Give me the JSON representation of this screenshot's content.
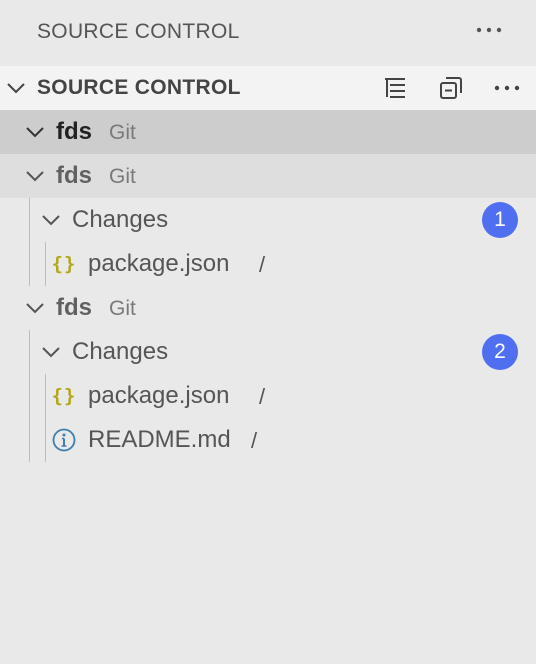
{
  "view": {
    "title": "SOURCE CONTROL",
    "more_icon": "ellipsis-icon"
  },
  "section": {
    "title": "SOURCE CONTROL",
    "actions": [
      {
        "name": "view-as-tree",
        "icon": "list-tree-icon"
      },
      {
        "name": "collapse-all",
        "icon": "collapse-all-icon"
      },
      {
        "name": "more-actions",
        "icon": "ellipsis-icon"
      }
    ]
  },
  "repositories": [
    {
      "name": "fds",
      "kind": "Git",
      "state": "selected"
    },
    {
      "name": "fds",
      "kind": "Git",
      "state": "hover",
      "group": {
        "label": "Changes",
        "count": "1",
        "files": [
          {
            "name": "package.json",
            "path": "/",
            "icon": "json-icon"
          }
        ]
      }
    },
    {
      "name": "fds",
      "kind": "Git",
      "state": "normal",
      "group": {
        "label": "Changes",
        "count": "2",
        "files": [
          {
            "name": "package.json",
            "path": "/",
            "icon": "json-icon"
          },
          {
            "name": "README.md",
            "path": "/",
            "icon": "info-icon"
          }
        ]
      }
    }
  ],
  "colors": {
    "badge": "#4f6ff0",
    "json_icon": "#b3a819",
    "info_icon": "#3c7fb0",
    "selected_row": "#cdcdcd"
  }
}
